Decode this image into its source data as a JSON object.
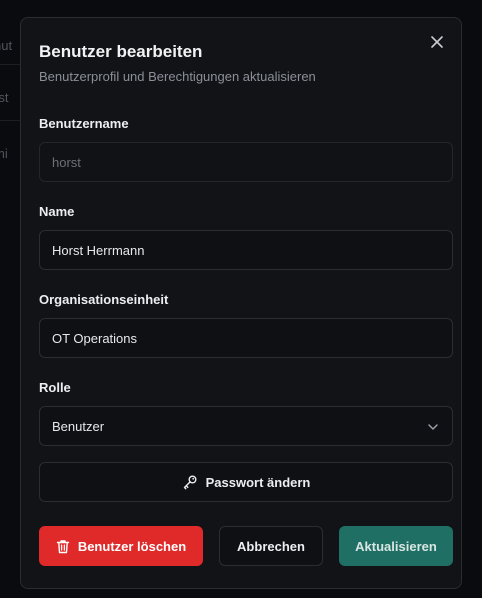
{
  "background": {
    "fragments": [
      "nut",
      "rst",
      "mi"
    ]
  },
  "dialog": {
    "title": "Benutzer bearbeiten",
    "subtitle": "Benutzerprofil und Berechtigungen aktualisieren",
    "close_icon": "close-icon"
  },
  "form": {
    "username": {
      "label": "Benutzername",
      "value": "horst",
      "disabled": true
    },
    "name": {
      "label": "Name",
      "value": "Horst Herrmann"
    },
    "org_unit": {
      "label": "Organisationseinheit",
      "value": "OT Operations"
    },
    "role": {
      "label": "Rolle",
      "value": "Benutzer",
      "icon": "chevron-down-icon"
    }
  },
  "actions": {
    "change_password": "Passwort ändern",
    "delete": "Benutzer löschen",
    "cancel": "Abbrechen",
    "update": "Aktualisieren"
  },
  "colors": {
    "danger": "#e02a2a",
    "primary": "#1f6f64",
    "surface": "#121317"
  }
}
